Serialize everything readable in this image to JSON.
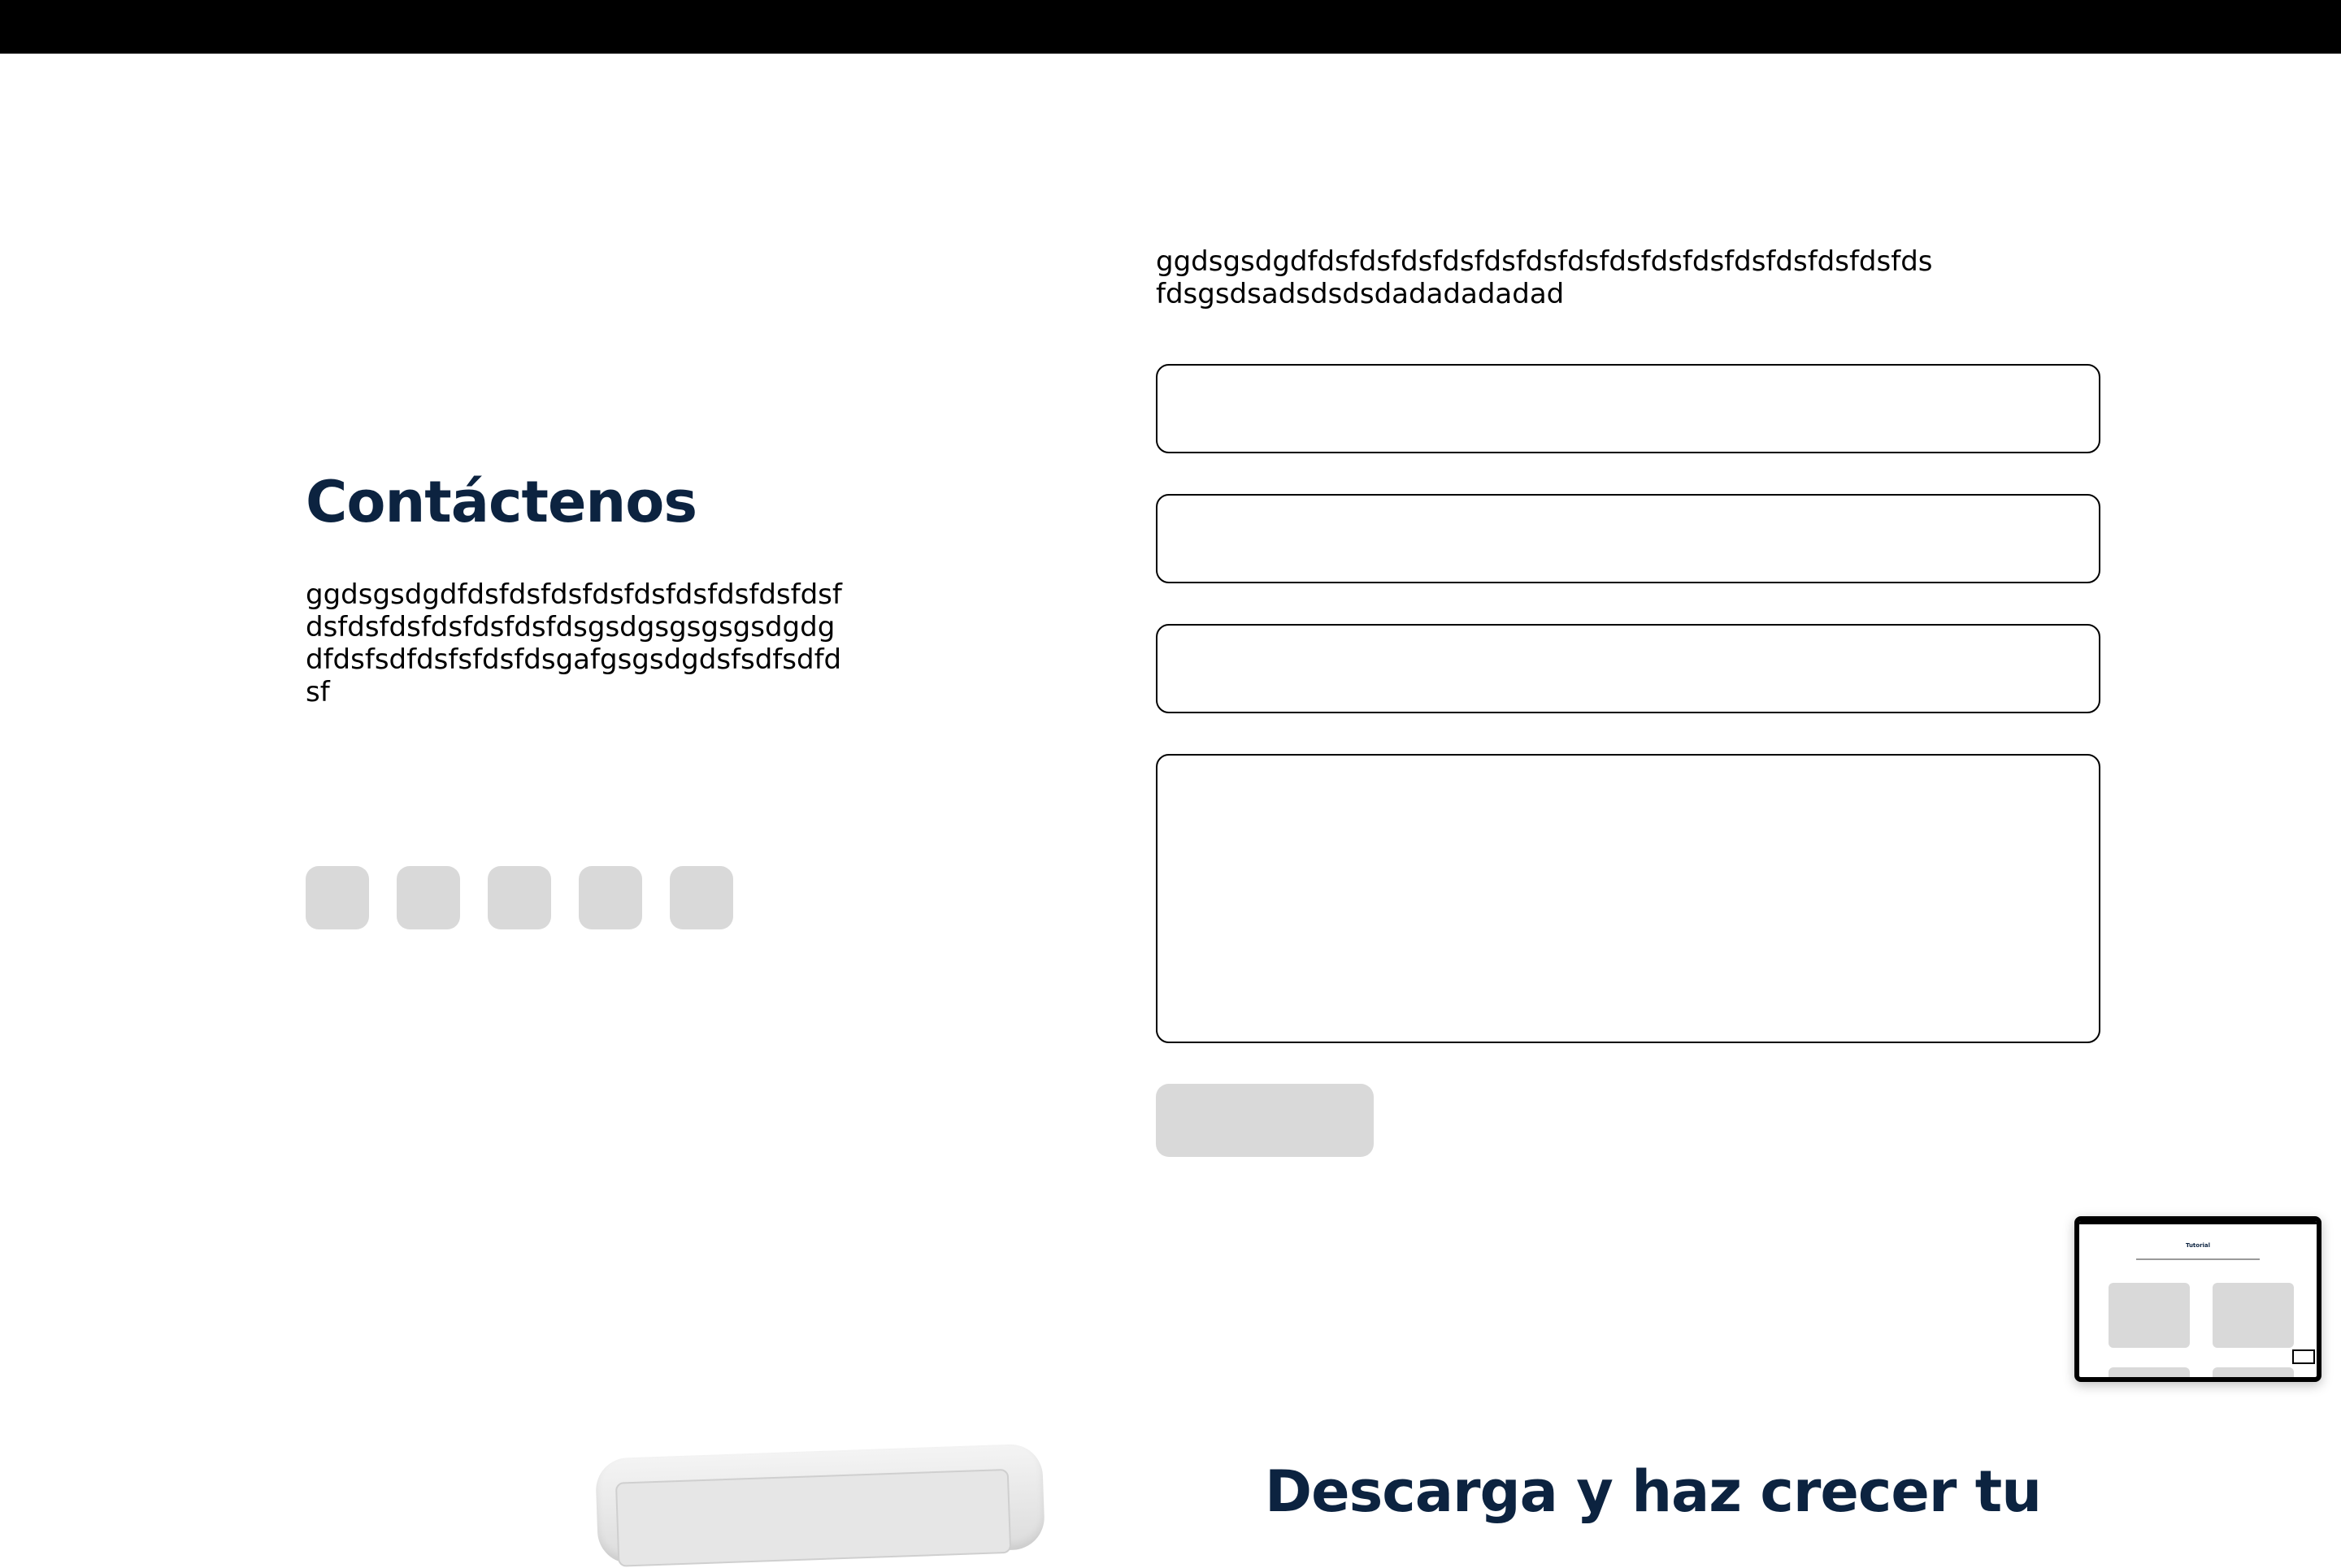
{
  "contact": {
    "title": "Contáctenos",
    "description": "ggdsgsdgdfdsfdsfdsfdsfdsfdsfdsfdsfdsfdsfdsfdsfdsfdsfdsfdsgsdgsgsgsgsdgdgdfdsfsdfdsfsfdsfdsgafgsgsdgdsfsdfsdfdsf",
    "social_icons": [
      "social-icon-1",
      "social-icon-2",
      "social-icon-3",
      "social-icon-4",
      "social-icon-5"
    ]
  },
  "form": {
    "intro": "ggdsgsdgdfdsfdsfdsfdsfdsfdsfdsfdsfdsfdsfdsfdsfdsfdsfdsfdsgsdsadsdsdsdadadadadad",
    "field_1_value": "",
    "field_2_value": "",
    "field_3_value": "",
    "message_value": "",
    "submit_label": ""
  },
  "preview": {
    "title": "Tutorial"
  },
  "download": {
    "title": "Descarga y haz crecer tu"
  },
  "colors": {
    "heading": "#0c2340",
    "placeholder_gray": "#d9d9d9",
    "topbar": "#000000"
  }
}
